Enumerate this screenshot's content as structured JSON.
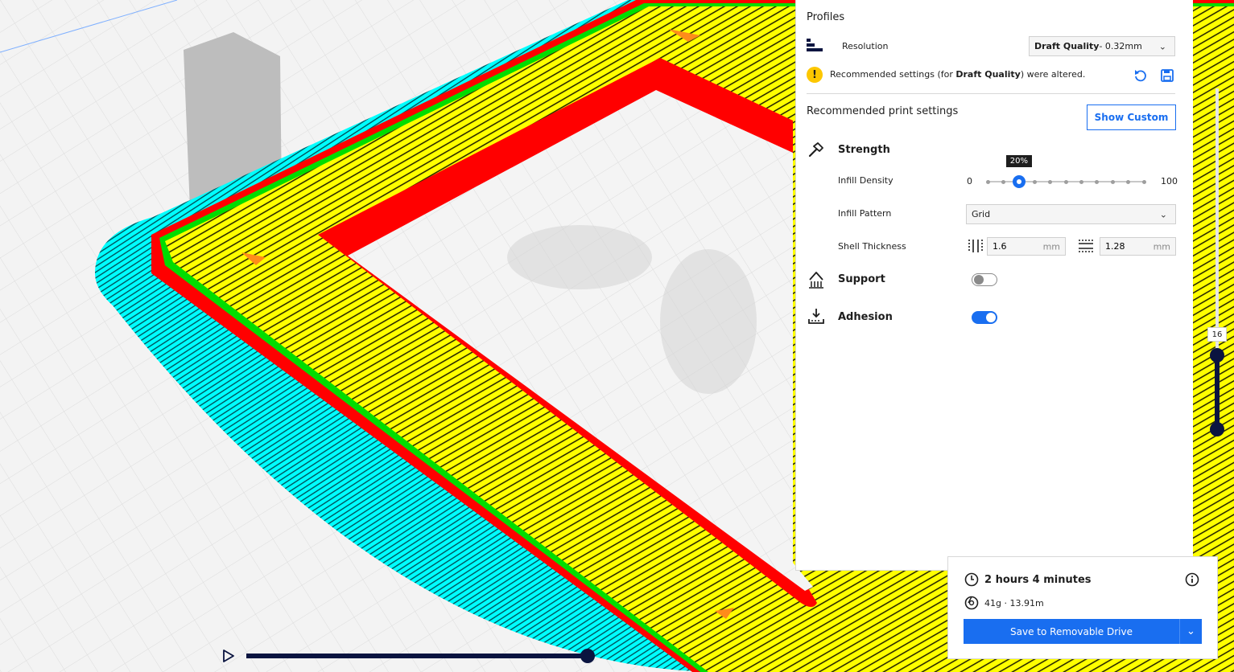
{
  "profiles": {
    "title": "Profiles",
    "resolution_label": "Resolution",
    "resolution_value_bold": "Draft Quality",
    "resolution_value_rest": " - 0.32mm",
    "warning_prefix": "Recommended settings (for ",
    "warning_bold": "Draft Quality",
    "warning_suffix": ") were altered."
  },
  "recommended": {
    "title": "Recommended print settings",
    "show_custom_label": "Show Custom"
  },
  "strength": {
    "title": "Strength",
    "infill_density_label": "Infill Density",
    "infill_min": "0",
    "infill_max": "100",
    "infill_value": 20,
    "infill_tooltip": "20%",
    "infill_pattern_label": "Infill Pattern",
    "infill_pattern_value": "Grid",
    "shell_thickness_label": "Shell Thickness",
    "wall_value": "1.6",
    "top_bottom_value": "1.28",
    "unit": "mm"
  },
  "support": {
    "title": "Support",
    "enabled": false
  },
  "adhesion": {
    "title": "Adhesion",
    "enabled": true
  },
  "print_info": {
    "time": "2 hours 4 minutes",
    "material": "41g · 13.91m",
    "save_label": "Save to Removable Drive"
  },
  "layer_view": {
    "current_layer": "16",
    "max_layers": 100
  },
  "simulation": {
    "progress": 1.0
  },
  "colors": {
    "accent": "#196ef0",
    "wall_red": "#ff0000",
    "infill_yellow": "#ffff00",
    "skirt_cyan": "#00ffff",
    "inner_wall_green": "#00ff00",
    "slider_navy": "#0a1440"
  }
}
